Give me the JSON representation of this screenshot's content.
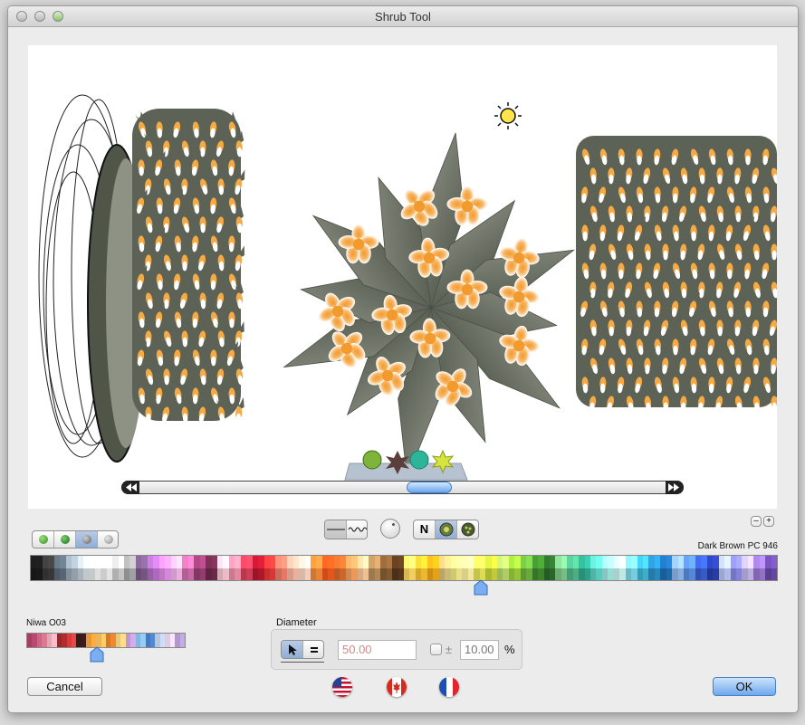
{
  "window": {
    "title": "Shrub Tool"
  },
  "preview": {
    "shrub_thumbnails": [
      "shrub-style-green",
      "shrub-style-dark-star",
      "shrub-style-teal",
      "shrub-style-yellow-star"
    ]
  },
  "view_toggles": {
    "north_label": "N"
  },
  "zoom": {
    "minus": "–",
    "plus": "+"
  },
  "palette_main": {
    "selected_color_name": "Dark Brown PC 946",
    "marker_fraction": 0.6
  },
  "palette_small": {
    "name": "Niwa O03",
    "marker_fraction": 0.44
  },
  "diameter": {
    "label": "Diameter",
    "value": "50.00",
    "plusminus": "±",
    "variation": "10.00",
    "unit": "%"
  },
  "buttons": {
    "cancel": "Cancel",
    "ok": "OK"
  },
  "flags": [
    "us-flag-icon",
    "canada-flag-icon",
    "france-flag-icon"
  ],
  "colors": {
    "accent": "#6aa5ec",
    "foliage": "#6c7264",
    "flower": "#f5a33b"
  }
}
